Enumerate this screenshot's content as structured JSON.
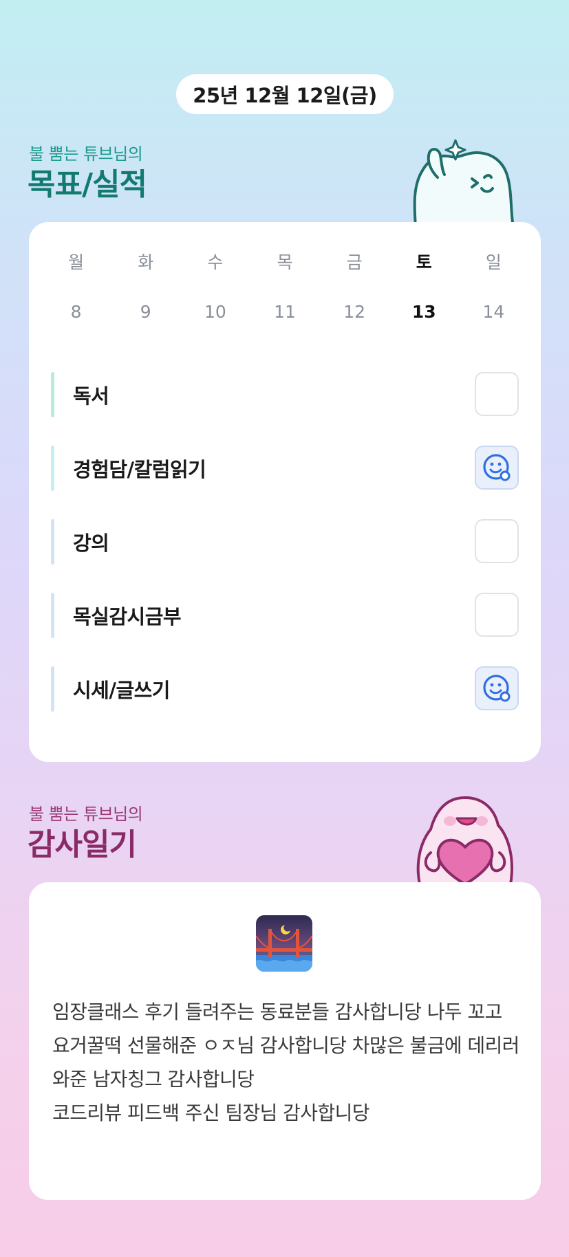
{
  "header": {
    "date": "25년 12월 12일(금)"
  },
  "goals": {
    "subtitle": "불 뿜는 튜브님의",
    "title": "목표/실적",
    "week": {
      "days": [
        "월",
        "화",
        "수",
        "목",
        "금",
        "토",
        "일"
      ],
      "dates": [
        "8",
        "9",
        "10",
        "11",
        "12",
        "13",
        "14"
      ],
      "active_index": 5
    },
    "items": [
      {
        "label": "독서",
        "bar_color": "#b9eadb",
        "done": false
      },
      {
        "label": "경험담/칼럼읽기",
        "bar_color": "#c5eef0",
        "done": true
      },
      {
        "label": "강의",
        "bar_color": "#d3e2f7",
        "done": false
      },
      {
        "label": "목실감시금부",
        "bar_color": "#d3e2f7",
        "done": false
      },
      {
        "label": "시세/글쓰기",
        "bar_color": "#d3e2f7",
        "done": true
      }
    ],
    "done_icon": "smile-face-icon",
    "accent_color": "#2f6fe0"
  },
  "thanks": {
    "subtitle": "불 뿜는 튜브님의",
    "title": "감사일기",
    "icon": "night-bridge-icon",
    "lines": [
      "임장클래스 후기 들려주는 동료분들 감사합니당 나두 꼬고",
      "요거꿀떡 선물해준 ㅇㅈ님 감사합니당 차많은 불금에 데리러와준 남자칭그 감사합니당",
      "코드리뷰 피드백 주신 팀장님 감사합니당"
    ]
  }
}
